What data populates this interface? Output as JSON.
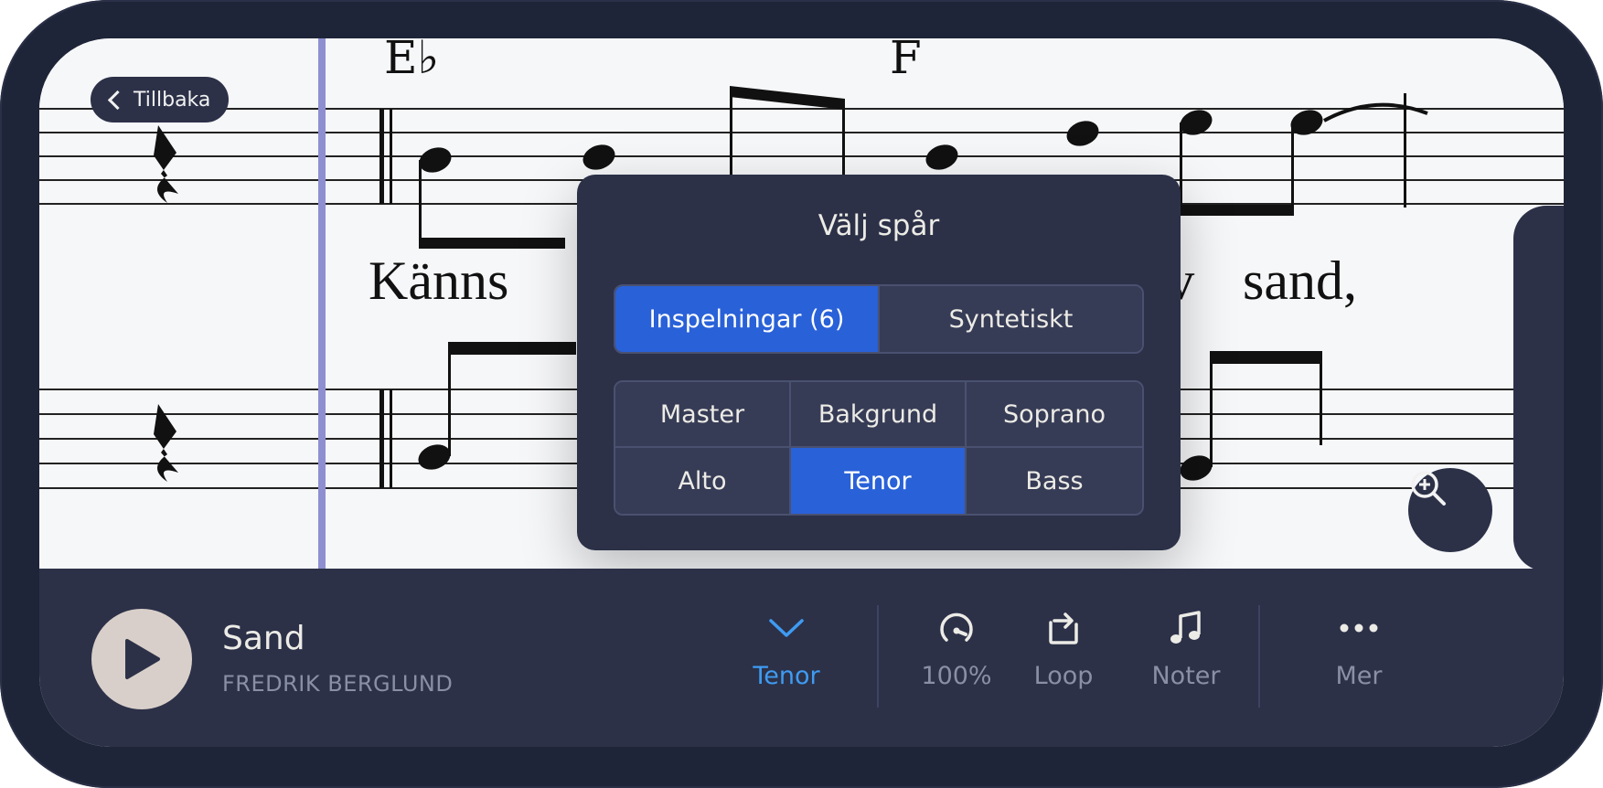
{
  "back_button": {
    "label": "Tillbaka"
  },
  "score": {
    "chords": [
      "E♭",
      "F"
    ],
    "lyrics": [
      "Känns",
      "–",
      "tav",
      "sand,"
    ]
  },
  "track_picker": {
    "title": "Välj spår",
    "source_tabs": [
      {
        "label": "Inspelningar (6)",
        "active": true
      },
      {
        "label": "Syntetiskt",
        "active": false
      }
    ],
    "tracks": [
      {
        "label": "Master",
        "active": false
      },
      {
        "label": "Bakgrund",
        "active": false
      },
      {
        "label": "Soprano",
        "active": false
      },
      {
        "label": "Alto",
        "active": false
      },
      {
        "label": "Tenor",
        "active": true
      },
      {
        "label": "Bass",
        "active": false
      }
    ]
  },
  "player": {
    "song_title": "Sand",
    "artist": "FREDRIK BERGLUND",
    "track_label": "Tenor",
    "speed_label": "100%",
    "loop_label": "Loop",
    "notes_label": "Noter",
    "more_label": "Mer"
  },
  "colors": {
    "accent": "#2961d8",
    "accent_text": "#3f9bf2",
    "panel": "#2c3148",
    "playhead": "#8e8fd0"
  }
}
